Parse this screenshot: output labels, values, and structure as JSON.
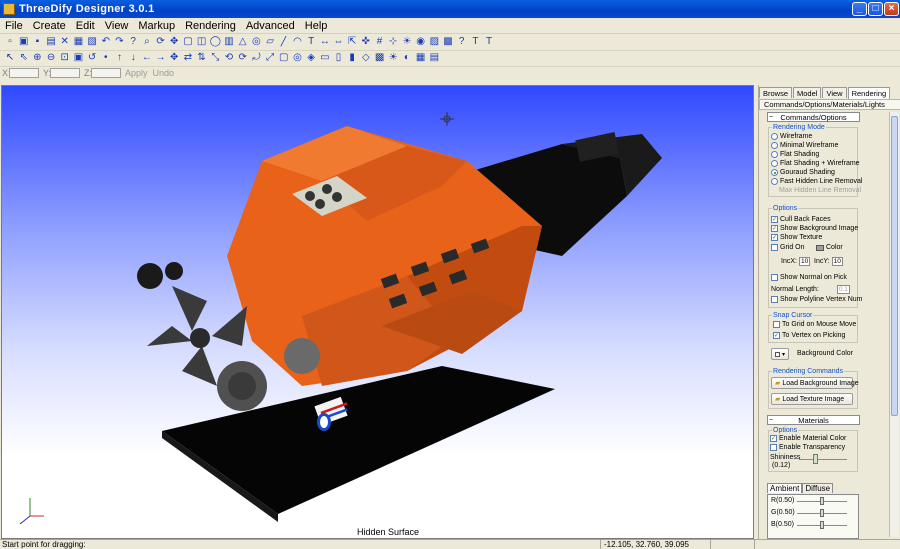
{
  "window": {
    "title": "ThreeDify Designer 3.0.1",
    "controls": {
      "minimize": "_",
      "maximize": "□",
      "close": "×"
    }
  },
  "menu": [
    "File",
    "Create",
    "Edit",
    "View",
    "Markup",
    "Rendering",
    "Advanced",
    "Help"
  ],
  "toolbar_row1_icons": [
    "new",
    "open",
    "save",
    "save-as",
    "cut",
    "print",
    "print-preview",
    "undo",
    "redo",
    "pick",
    "zoom",
    "rotate",
    "pan",
    "box",
    "cube",
    "sphere",
    "cylinder",
    "cone",
    "torus",
    "plane",
    "line",
    "arc",
    "text",
    "dim",
    "measure",
    "select",
    "snap",
    "grid",
    "axis",
    "light",
    "camera",
    "wire",
    "shade",
    "help",
    "tee",
    "tee2"
  ],
  "toolbar_row2_icons": [
    "arrow",
    "select-all",
    "zoom-in",
    "zoom-out",
    "zoom-box",
    "zoom-fit",
    "zoom-prev",
    "node",
    "up",
    "down",
    "left",
    "right",
    "move",
    "move-x",
    "move-y",
    "move-z",
    "rot-x",
    "rot-y",
    "rot-z",
    "scale",
    "fit",
    "orbit",
    "target",
    "view-front",
    "view-top",
    "view-side",
    "view-iso",
    "render",
    "light",
    "mat",
    "tex",
    "layer"
  ],
  "coordinates": {
    "labels": [
      "X:",
      "Y:",
      "Z:"
    ],
    "apply": "Apply",
    "undo": "Undo"
  },
  "viewport": {
    "caption": "Hidden Surface"
  },
  "panel": {
    "tabs": [
      "Browse",
      "Model",
      "View",
      "Rendering"
    ],
    "active_tab": "Rendering",
    "subtab": "Commands/Options/Materials/Lights",
    "commands_header": "Commands/Options",
    "rendering_mode": {
      "title": "Rendering Mode",
      "options": [
        {
          "label": "Wireframe",
          "selected": false,
          "disabled": false
        },
        {
          "label": "Minimal Wireframe",
          "selected": false,
          "disabled": false
        },
        {
          "label": "Flat Shading",
          "selected": false,
          "disabled": false
        },
        {
          "label": "Flat Shading + Wireframe",
          "selected": false,
          "disabled": false
        },
        {
          "label": "Gouraud Shading",
          "selected": true,
          "disabled": false
        },
        {
          "label": "Fast Hidden Line Removal",
          "selected": false,
          "disabled": false
        },
        {
          "label": "Max Hidden Line Removal",
          "selected": false,
          "disabled": true
        }
      ]
    },
    "options": {
      "title": "Options",
      "cull_back_faces": "Cull Back Faces",
      "show_background_image": "Show Background Image",
      "show_texture": "Show Texture",
      "grid_on": "Grid On",
      "color": "Color",
      "incx_label": "IncX:",
      "incx_value": "10",
      "incy_label": "IncY:",
      "incy_value": "10",
      "show_normal_on_pick": "Show Normal on Pick",
      "normal_length_label": "Normal Length:",
      "normal_length_value": "0.1",
      "show_polyline_vertex_num": "Show Polyline Vertex Num"
    },
    "snap_cursor": {
      "title": "Snap Cursor",
      "to_grid": "To Grid on Mouse Move",
      "to_vertex": "To Vertex on Picking"
    },
    "background_color": "Background Color",
    "rendering_commands": {
      "title": "Rendering Commands",
      "load_background": "Load Background Image",
      "load_texture": "Load Texture Image"
    },
    "materials_header": "Materials",
    "materials_options": {
      "title": "Options",
      "enable_material_color": "Enable Material Color",
      "enable_transparency": "Enable Transparency",
      "shininess_label": "Shininess",
      "shininess_value": "(0.12)",
      "shininess": 0.12
    },
    "material_tabs": [
      "Ambient",
      "Diffuse"
    ],
    "rgb": [
      {
        "label": "R(0.50)",
        "value": 0.5
      },
      {
        "label": "G(0.50)",
        "value": 0.5
      },
      {
        "label": "B(0.50)",
        "value": 0.5
      }
    ]
  },
  "status": {
    "message": "Start point for dragging:",
    "coords": "-12.105, 32.760, 39.095"
  },
  "colors": {
    "engine": "#e8621a",
    "title_blue": "#0042c8",
    "bg_top": "#3048ff"
  }
}
